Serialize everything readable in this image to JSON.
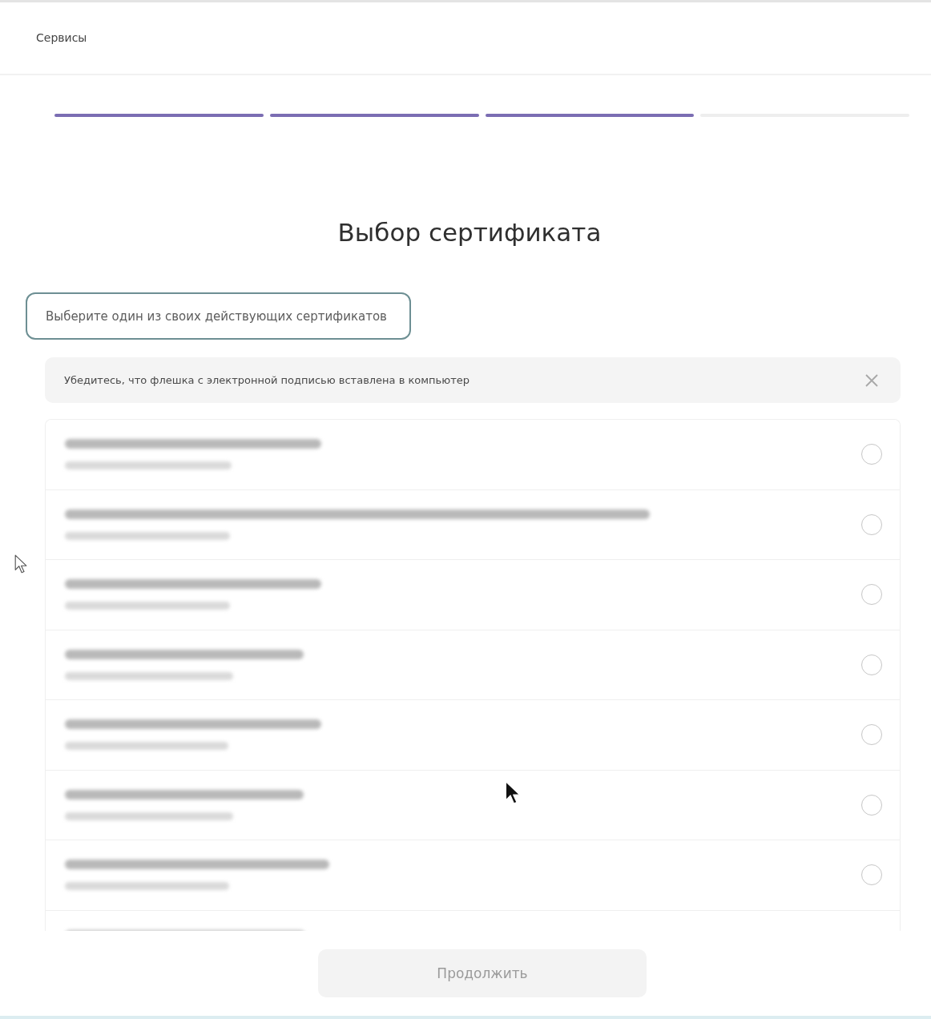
{
  "header": {
    "title": "Сервисы"
  },
  "progress": {
    "steps": [
      {
        "done": true
      },
      {
        "done": true
      },
      {
        "done": true
      },
      {
        "done": false
      }
    ]
  },
  "page_title": "Выбор сертификата",
  "subtitle": {
    "text": "Выберите один из своих действующих сертификатов",
    "focused": true
  },
  "alert": {
    "text": "Убедитесь, что флешка с электронной подписью вставлена в компьютер",
    "dismissible": true
  },
  "list": {
    "more_below": true,
    "items": [
      {
        "selected": false
      },
      {
        "selected": false
      },
      {
        "selected": false
      },
      {
        "selected": false
      },
      {
        "selected": false
      },
      {
        "selected": false
      },
      {
        "selected": false
      }
    ]
  },
  "continue_button": {
    "label": "Продолжить",
    "disabled": true
  }
}
